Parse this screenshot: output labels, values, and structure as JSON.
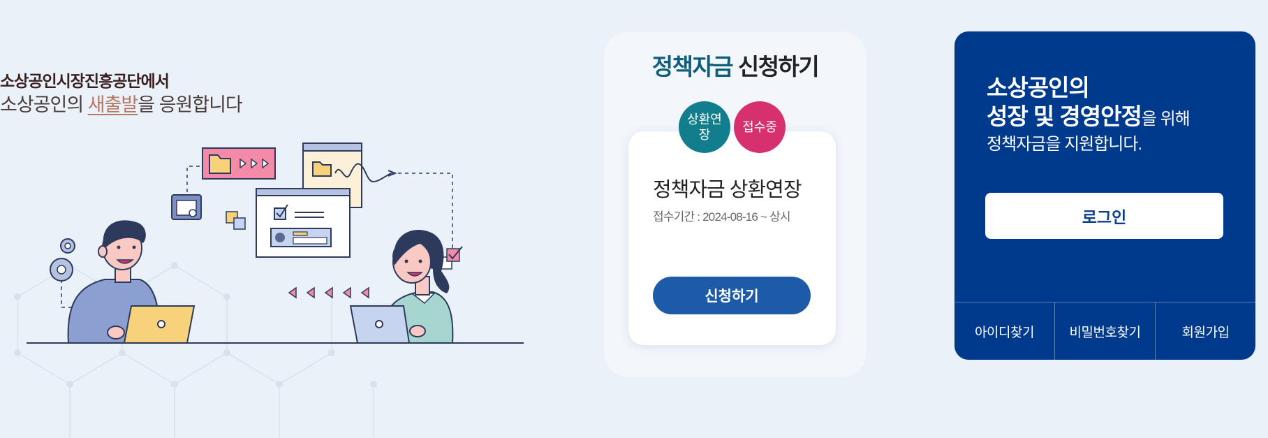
{
  "intro": {
    "sub": "소상공인시장진흥공단에서",
    "main_prefix": "소상공인의 ",
    "main_highlight": "새출발",
    "main_suffix": "을 응원합니다"
  },
  "policy": {
    "title_highlight": "정책자금",
    "title_rest": " 신청하기",
    "badges": [
      "상환연장",
      "접수중"
    ],
    "fund_name": "정책자금 상환연장",
    "period": "접수기간 : 2024-08-16 ~ 상시",
    "apply_label": "신청하기"
  },
  "login": {
    "line1": "소상공인의",
    "line2_bold": "성장 및 경영안정",
    "line2_rest": "을 위해",
    "line3": "정책자금을 지원합니다.",
    "login_label": "로그인",
    "links": [
      "아이디찾기",
      "비밀번호찾기",
      "회원가입"
    ]
  },
  "colors": {
    "background": "#eaf1f9",
    "login_panel": "#003a8c",
    "apply_button": "#1d5aa8",
    "badge_teal": "#127d8c",
    "badge_pink": "#d6306f"
  }
}
